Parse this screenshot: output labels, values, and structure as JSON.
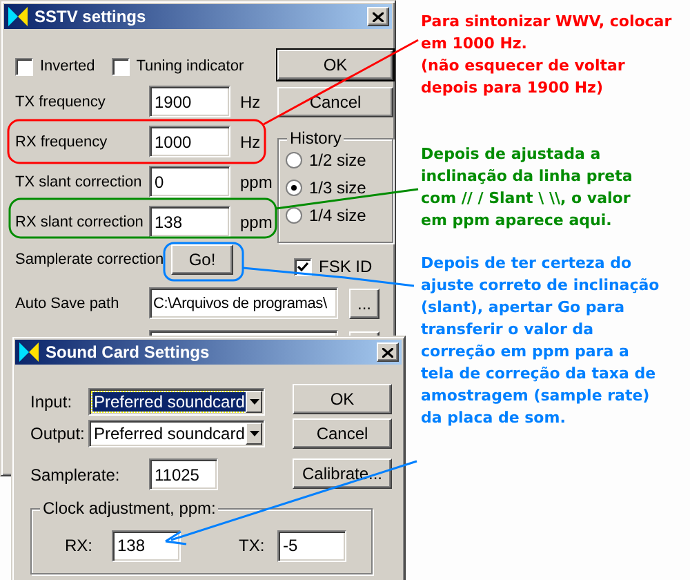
{
  "sstv_settings": {
    "title": "SSTV settings",
    "checkboxes": [
      {
        "label": "Inverted",
        "checked": false
      },
      {
        "label": "Tuning indicator",
        "checked": false
      }
    ],
    "fields": [
      {
        "label": "TX frequency",
        "value": "1900",
        "unit": "Hz"
      },
      {
        "label": "RX frequency",
        "value": "1000",
        "unit": "Hz"
      },
      {
        "label": "TX slant correction",
        "value": "0",
        "unit": "ppm"
      },
      {
        "label": "RX slant correction",
        "value": "138",
        "unit": "ppm"
      }
    ],
    "buttons": [
      "OK",
      "Cancel"
    ],
    "history": {
      "label": "History",
      "options": [
        {
          "label": "1/2 size",
          "selected": false
        },
        {
          "label": "1/3 size",
          "selected": true
        },
        {
          "label": "1/4 size",
          "selected": false
        }
      ]
    },
    "samplerate_correction": {
      "label": "Samplerate correction",
      "button": "Go!"
    },
    "fsk_id": {
      "label": "FSK ID",
      "checked": true
    },
    "auto_save_path": {
      "label": "Auto Save path",
      "value": "C:\\Arquivos de programas\\",
      "button": "..."
    }
  },
  "sound_card_settings": {
    "title": "Sound Card Settings",
    "devices": [
      {
        "label": "Input:",
        "value": "Preferred soundcard",
        "focused": true
      },
      {
        "label": "Output:",
        "value": "Preferred soundcard",
        "focused": false
      }
    ],
    "samplerate": {
      "label": "Samplerate:",
      "value": "11025"
    },
    "buttons": [
      "OK",
      "Cancel",
      "Calibrate..."
    ],
    "clock_adjustment": {
      "label": "Clock adjustment, ppm:",
      "rx": {
        "label": "RX:",
        "value": "138"
      },
      "tx": {
        "label": "TX:",
        "value": "-5"
      }
    }
  },
  "annotations": [
    {
      "color": "#ff0000",
      "lines": [
        "Para sintonizar WWV, colocar",
        "em 1000 Hz.",
        "(não esquecer de voltar",
        "depois para 1900 Hz)"
      ]
    },
    {
      "color": "#008c00",
      "lines": [
        "Depois de ajustada a",
        "inclinação da linha preta",
        "com // / Slant \\ \\\\, o valor",
        "em ppm aparece aqui."
      ]
    },
    {
      "color": "#0080ff",
      "lines": [
        "Depois de ter certeza do",
        "ajuste correto de inclinação",
        "(slant), apertar Go para",
        "transferir o valor da",
        "correção em ppm para a",
        "tela de correção da taxa de",
        "amostragem (sample rate)",
        "da placa de som."
      ]
    }
  ]
}
